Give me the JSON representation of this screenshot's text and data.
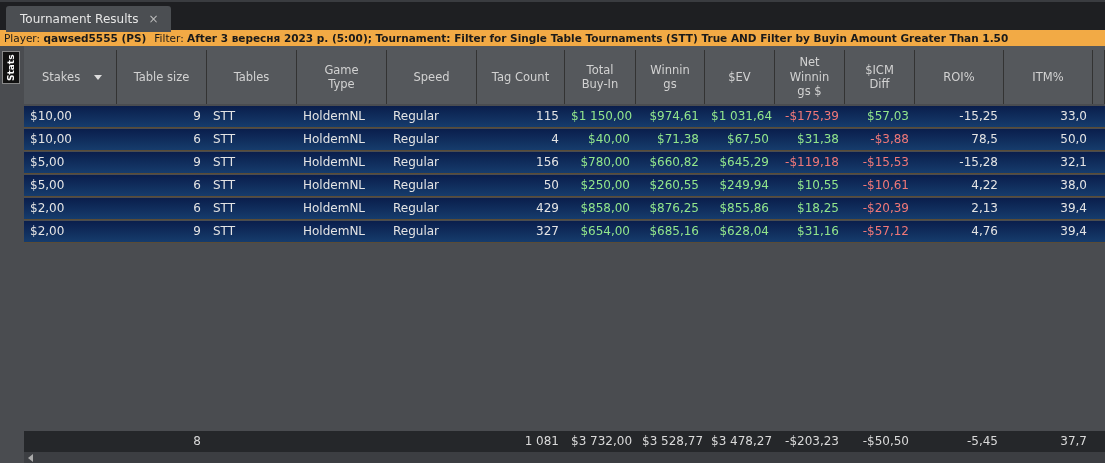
{
  "tab": {
    "title": "Tournament Results",
    "close": "×",
    "selected": true
  },
  "filter_bar": {
    "player": "Player: **qawsed5555 (PS)**",
    "filter": "Filter: **After 3 вересня 2023 р. (5:00); Tournament: Filter for Single Table Tournaments (STT) True AND Filter by Buyin Amount Greater Than 1.50**"
  },
  "side_tab": {
    "label": "Stats"
  },
  "table": {
    "columns": [
      {
        "label": "Stakes",
        "sorted": true
      },
      {
        "label": "Table size",
        "sorted": false
      },
      {
        "label": "Tables",
        "sorted": false
      },
      {
        "label": "Game Type",
        "sorted": false
      },
      {
        "label": "Speed",
        "sorted": false
      },
      {
        "label": "Tag Count",
        "sorted": false
      },
      {
        "label": "Total Buy-In",
        "sorted": false
      },
      {
        "label": "Winnings",
        "sorted": false
      },
      {
        "label": "$EV",
        "sorted": false
      },
      {
        "label": "Net Winnings $",
        "sorted": false
      },
      {
        "label": "$ICM Diff",
        "sorted": false
      },
      {
        "label": "ROI%",
        "sorted": false
      },
      {
        "label": "ITM%",
        "sorted": false
      }
    ],
    "rows": [
      {
        "cells": [
          {
            "text": "$10,00"
          },
          {
            "text": "9"
          },
          {
            "text": "STT"
          },
          {
            "text": "HoldemNL"
          },
          {
            "text": "Regular"
          },
          {
            "text": "115"
          },
          {
            "text": "$1 150,00",
            "loss": false
          },
          {
            "text": "$974,61",
            "loss": false
          },
          {
            "text": "$1 031,64",
            "loss": false
          },
          {
            "text": "-$175,39",
            "loss": true
          },
          {
            "text": "$57,03",
            "loss": false
          },
          {
            "text": "-15,25"
          },
          {
            "text": "33,0"
          }
        ]
      },
      {
        "cells": [
          {
            "text": "$10,00"
          },
          {
            "text": "6"
          },
          {
            "text": "STT"
          },
          {
            "text": "HoldemNL"
          },
          {
            "text": "Regular"
          },
          {
            "text": "4"
          },
          {
            "text": "$40,00",
            "loss": false
          },
          {
            "text": "$71,38",
            "loss": false
          },
          {
            "text": "$67,50",
            "loss": false
          },
          {
            "text": "$31,38",
            "loss": false
          },
          {
            "text": "-$3,88",
            "loss": true
          },
          {
            "text": "78,5"
          },
          {
            "text": "50,0"
          }
        ]
      },
      {
        "cells": [
          {
            "text": "$5,00"
          },
          {
            "text": "9"
          },
          {
            "text": "STT"
          },
          {
            "text": "HoldemNL"
          },
          {
            "text": "Regular"
          },
          {
            "text": "156"
          },
          {
            "text": "$780,00",
            "loss": false
          },
          {
            "text": "$660,82",
            "loss": false
          },
          {
            "text": "$645,29",
            "loss": false
          },
          {
            "text": "-$119,18",
            "loss": true
          },
          {
            "text": "-$15,53",
            "loss": true
          },
          {
            "text": "-15,28"
          },
          {
            "text": "32,1"
          }
        ]
      },
      {
        "cells": [
          {
            "text": "$5,00"
          },
          {
            "text": "6"
          },
          {
            "text": "STT"
          },
          {
            "text": "HoldemNL"
          },
          {
            "text": "Regular"
          },
          {
            "text": "50"
          },
          {
            "text": "$250,00",
            "loss": false
          },
          {
            "text": "$260,55",
            "loss": false
          },
          {
            "text": "$249,94",
            "loss": false
          },
          {
            "text": "$10,55",
            "loss": false
          },
          {
            "text": "-$10,61",
            "loss": true
          },
          {
            "text": "4,22"
          },
          {
            "text": "38,0"
          }
        ]
      },
      {
        "cells": [
          {
            "text": "$2,00"
          },
          {
            "text": "6"
          },
          {
            "text": "STT"
          },
          {
            "text": "HoldemNL"
          },
          {
            "text": "Regular"
          },
          {
            "text": "429"
          },
          {
            "text": "$858,00",
            "loss": false
          },
          {
            "text": "$876,25",
            "loss": false
          },
          {
            "text": "$855,86",
            "loss": false
          },
          {
            "text": "$18,25",
            "loss": false
          },
          {
            "text": "-$20,39",
            "loss": true
          },
          {
            "text": "2,13"
          },
          {
            "text": "39,4"
          }
        ]
      },
      {
        "cells": [
          {
            "text": "$2,00"
          },
          {
            "text": "9"
          },
          {
            "text": "STT"
          },
          {
            "text": "HoldemNL"
          },
          {
            "text": "Regular"
          },
          {
            "text": "327"
          },
          {
            "text": "$654,00",
            "loss": false
          },
          {
            "text": "$685,16",
            "loss": false
          },
          {
            "text": "$628,04",
            "loss": false
          },
          {
            "text": "$31,16",
            "loss": false
          },
          {
            "text": "-$57,12",
            "loss": true
          },
          {
            "text": "4,76"
          },
          {
            "text": "39,4"
          }
        ]
      }
    ],
    "totals": [
      "8",
      "1 081",
      "$3 732,00",
      "$3 528,77",
      "$3 478,27",
      "-$203,23",
      "-$50,50",
      "-5,45",
      "37,7"
    ]
  }
}
